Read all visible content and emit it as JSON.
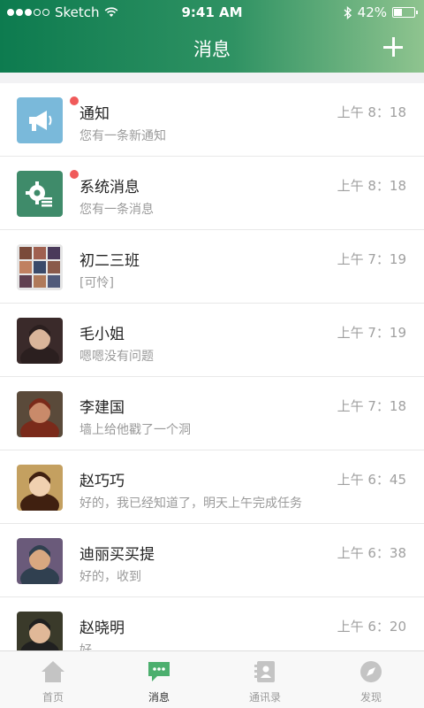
{
  "status_bar": {
    "carrier": "Sketch",
    "time": "9:41 AM",
    "battery": "42%",
    "battery_level": 0.42
  },
  "nav": {
    "title": "消息",
    "add_icon": "plus-icon"
  },
  "messages": [
    {
      "name": "通知",
      "preview": "您有一条新通知",
      "time": "上午 8：18",
      "unread": true,
      "avatar": "megaphone-icon"
    },
    {
      "name": "系统消息",
      "preview": "您有一条消息",
      "time": "上午 8：18",
      "unread": true,
      "avatar": "gear-list-icon"
    },
    {
      "name": "初二三班",
      "preview": "[可怜]",
      "time": "上午 7：19",
      "unread": false,
      "avatar": "group-photo"
    },
    {
      "name": "毛小姐",
      "preview": "嗯嗯没有问题",
      "time": "上午 7：19",
      "unread": false,
      "avatar": "user-photo"
    },
    {
      "name": "李建国",
      "preview": "墙上给他戳了一个洞",
      "time": "上午 7：18",
      "unread": false,
      "avatar": "user-photo"
    },
    {
      "name": "赵巧巧",
      "preview": "好的，我已经知道了，明天上午完成任务",
      "time": "上午 6：45",
      "unread": false,
      "avatar": "user-photo"
    },
    {
      "name": "迪丽买买提",
      "preview": "好的，收到",
      "time": "上午 6：38",
      "unread": false,
      "avatar": "user-photo"
    },
    {
      "name": "赵晓明",
      "preview": "好",
      "time": "上午 6：20",
      "unread": false,
      "avatar": "user-photo"
    }
  ],
  "tabs": [
    {
      "label": "首页",
      "icon": "home-icon",
      "active": false
    },
    {
      "label": "消息",
      "icon": "chat-icon",
      "active": true
    },
    {
      "label": "通讯录",
      "icon": "contacts-icon",
      "active": false
    },
    {
      "label": "发现",
      "icon": "compass-icon",
      "active": false
    }
  ],
  "colors": {
    "header_start": "#0d7b4f",
    "header_end": "#8fc48f",
    "accent": "#4caf6e",
    "badge": "#f05a5a"
  }
}
